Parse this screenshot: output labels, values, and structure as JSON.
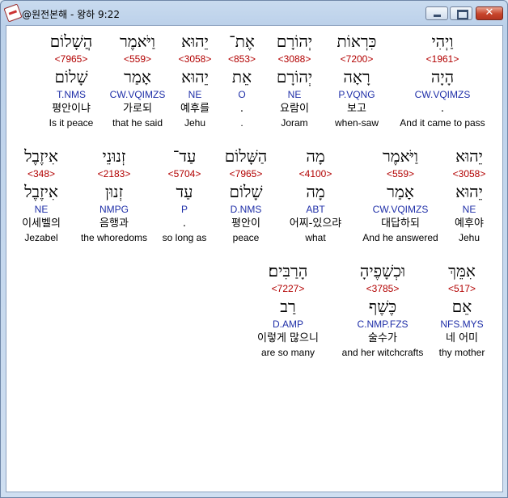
{
  "window": {
    "title": "@원전본해 - 왕하 9:22"
  },
  "rows": [
    {
      "words": [
        {
          "heb": "וַיְהִי",
          "strong": "<1961>",
          "lemma": "הָיָה",
          "morph": "CW.VQIMZS",
          "kor": ".",
          "eng": "And it came to pass"
        },
        {
          "heb": "כִּרְאוֹת",
          "strong": "<7200>",
          "lemma": "רָאָה",
          "morph": "P.VQNG",
          "kor": "보고",
          "eng": "when-saw"
        },
        {
          "heb": "יְהוֹרָם",
          "strong": "<3088>",
          "lemma": "יְהוֹרָם",
          "morph": "NE",
          "kor": "요람이",
          "eng": "Joram"
        },
        {
          "heb": "אֶת־",
          "strong": "<853>",
          "lemma": "אֵת",
          "morph": "O",
          "kor": ".",
          "eng": "."
        },
        {
          "heb": "יֵהוּא",
          "strong": "<3058>",
          "lemma": "יֵהוּא",
          "morph": "NE",
          "kor": "예후를",
          "eng": "Jehu"
        },
        {
          "heb": "וַיֹּאמֶר",
          "strong": "<559>",
          "lemma": "אָמַר",
          "morph": "CW.VQIMZS",
          "kor": "가로되",
          "eng": "that he said"
        },
        {
          "heb": "הֲשָׁלוֹם",
          "strong": "<7965>",
          "lemma": "שָׁלוֹם",
          "morph": "T.NMS",
          "kor": "평안이냐",
          "eng": "Is it peace"
        }
      ]
    },
    {
      "words": [
        {
          "heb": "יֵהוּא",
          "strong": "<3058>",
          "lemma": "יֵהוּא",
          "morph": "NE",
          "kor": "예후야",
          "eng": "Jehu"
        },
        {
          "heb": "וַיֹּאמֶר",
          "strong": "<559>",
          "lemma": "אָמַר",
          "morph": "CW.VQIMZS",
          "kor": "대답하되",
          "eng": "And he answered"
        },
        {
          "heb": "מָה",
          "strong": "<4100>",
          "lemma": "מָה",
          "morph": "ABT",
          "kor": "어찌-있으랴",
          "eng": "what"
        },
        {
          "heb": "הַשָּׁלוֹם",
          "strong": "<7965>",
          "lemma": "שָׁלוֹם",
          "morph": "D.NMS",
          "kor": "평안이",
          "eng": "peace"
        },
        {
          "heb": "עַד־",
          "strong": "<5704>",
          "lemma": "עַד",
          "morph": "P",
          "kor": ".",
          "eng": "so long as"
        },
        {
          "heb": "זְנוּנֵי",
          "strong": "<2183>",
          "lemma": "זְנוּן",
          "morph": "NMPG",
          "kor": "음행과",
          "eng": "the whoredoms"
        },
        {
          "heb": "אִיזֶבֶל",
          "strong": "<348>",
          "lemma": "אִיזֶבֶל",
          "morph": "NE",
          "kor": "이세벨의",
          "eng": "Jezabel"
        }
      ]
    },
    {
      "words": [
        {
          "heb": "אִמֵּךְ",
          "strong": "<517>",
          "lemma": "אֵם",
          "morph": "NFS.MYS",
          "kor": "네 어미",
          "eng": "thy mother"
        },
        {
          "heb": "וּכְשָׁפֶיהָ",
          "strong": "<3785>",
          "lemma": "כֶּשֶׁף",
          "morph": "C.NMP.FZS",
          "kor": "술수가",
          "eng": "and her witchcrafts"
        },
        {
          "heb": "הָרַבִּים׃",
          "strong": "<7227>",
          "lemma": "רַב",
          "morph": "D.AMP",
          "kor": "이렇게 많으니",
          "eng": "are so many"
        }
      ]
    }
  ]
}
